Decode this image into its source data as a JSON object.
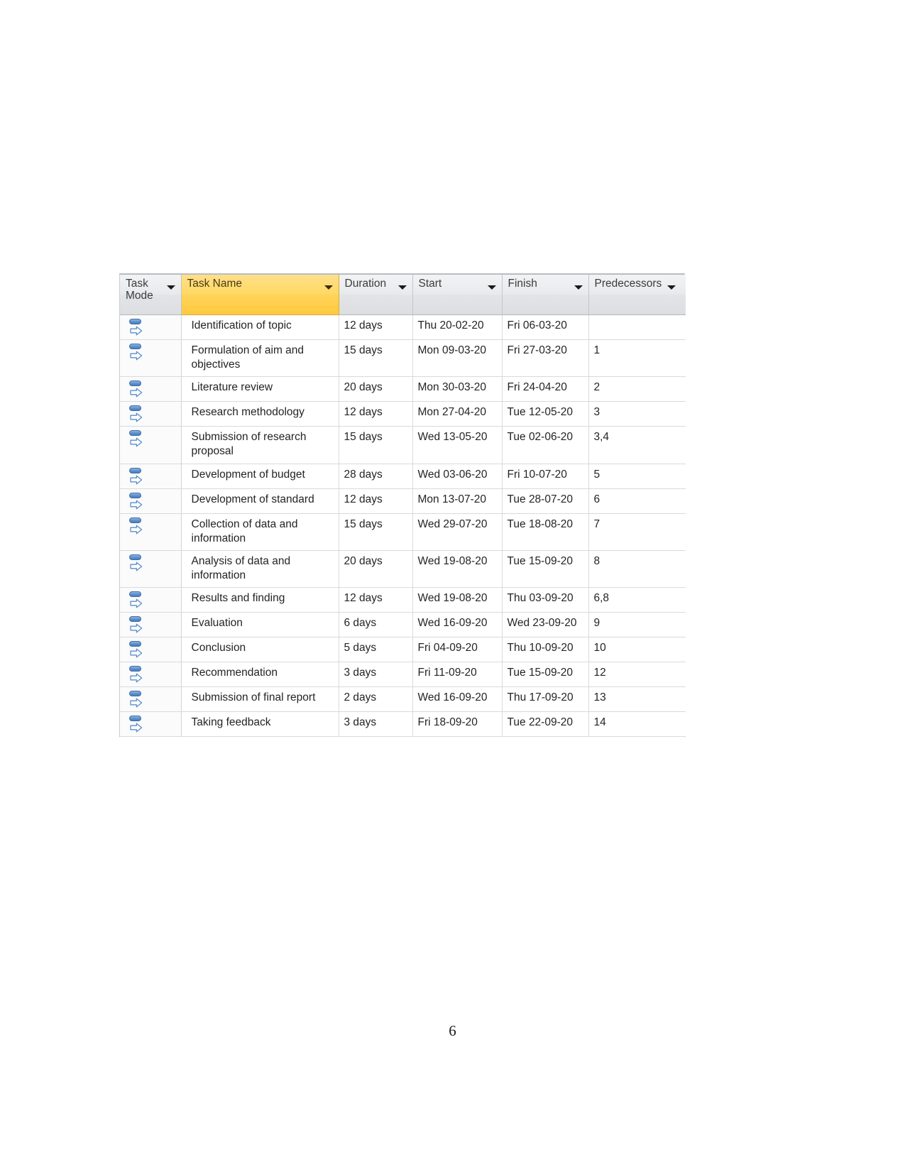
{
  "document": {
    "page_number": "6"
  },
  "grid": {
    "title": "Project task schedule grid",
    "colors": {
      "header_gray": "#e4e6e9",
      "selected_column": "#ffd966",
      "grid_line": "#d7dade",
      "task_mode_icon_blue": "#4a7cbb",
      "text": "#242424"
    },
    "columns": [
      {
        "key": "task_mode",
        "label": "Task Mode",
        "selected": false,
        "has_filter": true
      },
      {
        "key": "task_name",
        "label": "Task Name",
        "selected": true,
        "has_filter": true
      },
      {
        "key": "duration",
        "label": "Duration",
        "selected": false,
        "has_filter": true
      },
      {
        "key": "start",
        "label": "Start",
        "selected": false,
        "has_filter": true
      },
      {
        "key": "finish",
        "label": "Finish",
        "selected": false,
        "has_filter": true
      },
      {
        "key": "predecessors",
        "label": "Predecessors",
        "selected": false,
        "has_filter": true
      }
    ],
    "task_mode_icon": "manually-scheduled-icon",
    "rows": [
      {
        "task_name": "Identification of topic",
        "duration": "12 days",
        "start": "Thu 20-02-20",
        "finish": "Fri 06-03-20",
        "predecessors": ""
      },
      {
        "task_name": "Formulation of aim and objectives",
        "duration": "15 days",
        "start": "Mon 09-03-20",
        "finish": "Fri 27-03-20",
        "predecessors": "1"
      },
      {
        "task_name": "Literature review",
        "duration": "20 days",
        "start": "Mon 30-03-20",
        "finish": "Fri 24-04-20",
        "predecessors": "2"
      },
      {
        "task_name": "Research methodology",
        "duration": "12 days",
        "start": "Mon 27-04-20",
        "finish": "Tue 12-05-20",
        "predecessors": "3"
      },
      {
        "task_name": "Submission of research proposal",
        "duration": "15 days",
        "start": "Wed 13-05-20",
        "finish": "Tue 02-06-20",
        "predecessors": "3,4"
      },
      {
        "task_name": "Development of budget",
        "duration": "28 days",
        "start": "Wed 03-06-20",
        "finish": "Fri 10-07-20",
        "predecessors": "5"
      },
      {
        "task_name": "Development of standard",
        "duration": "12 days",
        "start": "Mon 13-07-20",
        "finish": "Tue 28-07-20",
        "predecessors": "6"
      },
      {
        "task_name": "Collection of data and information",
        "duration": "15 days",
        "start": "Wed 29-07-20",
        "finish": "Tue 18-08-20",
        "predecessors": "7"
      },
      {
        "task_name": "Analysis of data and information",
        "duration": "20 days",
        "start": "Wed 19-08-20",
        "finish": "Tue 15-09-20",
        "predecessors": "8"
      },
      {
        "task_name": "Results and finding",
        "duration": "12 days",
        "start": "Wed 19-08-20",
        "finish": "Thu 03-09-20",
        "predecessors": "6,8"
      },
      {
        "task_name": "Evaluation",
        "duration": "6 days",
        "start": "Wed 16-09-20",
        "finish": "Wed 23-09-20",
        "predecessors": "9"
      },
      {
        "task_name": "Conclusion",
        "duration": "5 days",
        "start": "Fri 04-09-20",
        "finish": "Thu 10-09-20",
        "predecessors": "10"
      },
      {
        "task_name": "Recommendation",
        "duration": "3 days",
        "start": "Fri 11-09-20",
        "finish": "Tue 15-09-20",
        "predecessors": "12"
      },
      {
        "task_name": "Submission of final report",
        "duration": "2 days",
        "start": "Wed 16-09-20",
        "finish": "Thu 17-09-20",
        "predecessors": "13"
      },
      {
        "task_name": "Taking feedback",
        "duration": "3 days",
        "start": "Fri 18-09-20",
        "finish": "Tue 22-09-20",
        "predecessors": "14"
      }
    ]
  }
}
